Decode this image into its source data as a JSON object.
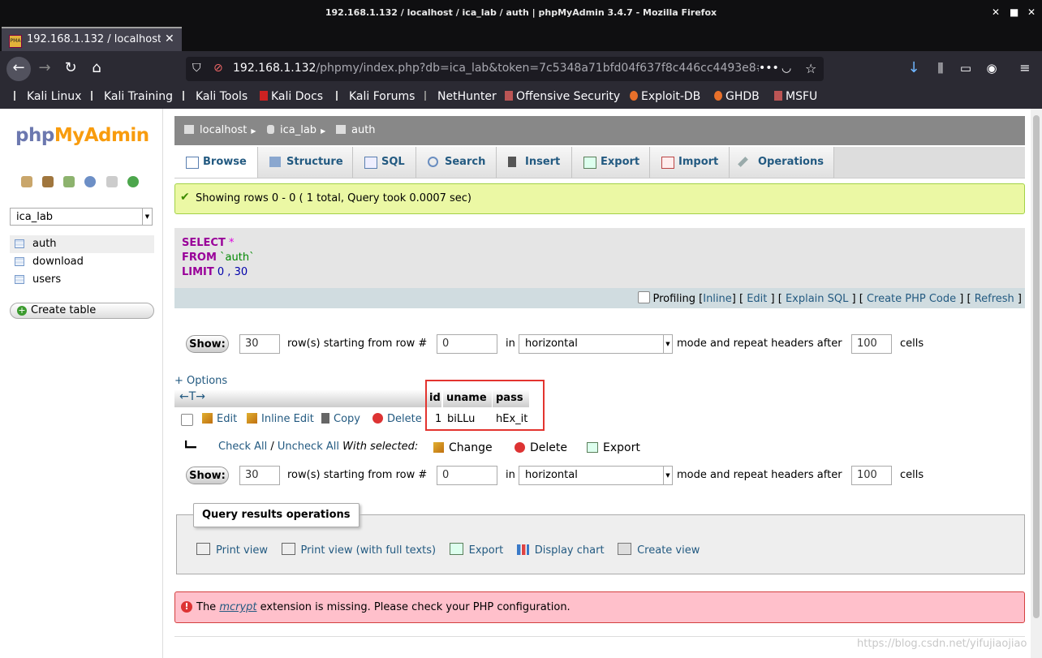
{
  "window": {
    "title": "192.168.1.132 / localhost / ica_lab / auth | phpMyAdmin 3.4.7 - Mozilla Firefox",
    "controls": [
      "✕",
      "■",
      "✕"
    ]
  },
  "tab": {
    "label": "192.168.1.132 / localhost",
    "favicon": "PMA",
    "close": "✕"
  },
  "new_tab": "+",
  "url": {
    "host": "192.168.1.132",
    "path": "/phpmy/index.php?db=ica_lab&token=7c5348a71bfd04f637f8c446cc4493e8#",
    "more": "•••"
  },
  "bookmarks": [
    {
      "label": "Kali Linux"
    },
    {
      "label": "Kali Training"
    },
    {
      "label": "Kali Tools"
    },
    {
      "label": "Kali Docs"
    },
    {
      "label": "Kali Forums"
    },
    {
      "label": "NetHunter"
    },
    {
      "label": "Offensive Security"
    },
    {
      "label": "Exploit-DB"
    },
    {
      "label": "GHDB"
    },
    {
      "label": "MSFU"
    }
  ],
  "sidebar": {
    "logo_php": "php",
    "logo_myadmin": "MyAdmin",
    "db_selected": "ica_lab",
    "tables": [
      {
        "label": "auth"
      },
      {
        "label": "download"
      },
      {
        "label": "users"
      }
    ],
    "create_table": "Create table"
  },
  "breadcrumb": {
    "server": "localhost",
    "database": "ica_lab",
    "table": "auth"
  },
  "tabs": [
    {
      "label": "Browse"
    },
    {
      "label": "Structure"
    },
    {
      "label": "SQL"
    },
    {
      "label": "Search"
    },
    {
      "label": "Insert"
    },
    {
      "label": "Export"
    },
    {
      "label": "Import"
    },
    {
      "label": "Operations"
    }
  ],
  "success_message": "Showing rows 0 - 0 ( 1 total, Query took 0.0007 sec)",
  "sql": {
    "line1_kw": "SELECT",
    "line1_rest": " *",
    "line2_kw": "FROM",
    "line2_rest": " `auth`",
    "line3_kw": "LIMIT",
    "line3_rest": " 0 , 30"
  },
  "sql_links": {
    "profiling": "Profiling",
    "inline": "Inline",
    "edit": "Edit",
    "explain": "Explain SQL",
    "create_php": "Create PHP Code",
    "refresh": "Refresh"
  },
  "nav": {
    "show": "Show:",
    "rows": "30",
    "starting_text": "row(s) starting from row #",
    "start_row": "0",
    "in_text": "in",
    "mode": "horizontal",
    "repeat_text": "mode and repeat headers after",
    "repeat_cells": "100",
    "cells_text": "cells"
  },
  "options_link": "+ Options",
  "result": {
    "arrows": "←T→",
    "columns": [
      "id",
      "uname",
      "pass"
    ],
    "row": {
      "id": "1",
      "uname": "biLLu",
      "pass": "hEx_it"
    },
    "actions": {
      "edit": "Edit",
      "inline_edit": "Inline Edit",
      "copy": "Copy",
      "delete": "Delete"
    }
  },
  "with_selected": {
    "check_all": "Check All",
    "separator": " / ",
    "uncheck_all": "Uncheck All",
    "with_selected": "With selected:",
    "change": "Change",
    "delete": "Delete",
    "export": "Export"
  },
  "query_ops": {
    "legend": "Query results operations",
    "print_view": "Print view",
    "print_full": "Print view (with full texts)",
    "export": "Export",
    "display_chart": "Display chart",
    "create_view": "Create view"
  },
  "error": {
    "pre": "The ",
    "link": "mcrypt",
    "post": " extension is missing. Please check your PHP configuration."
  },
  "watermark": "https://blog.csdn.net/yifujiaojiao"
}
